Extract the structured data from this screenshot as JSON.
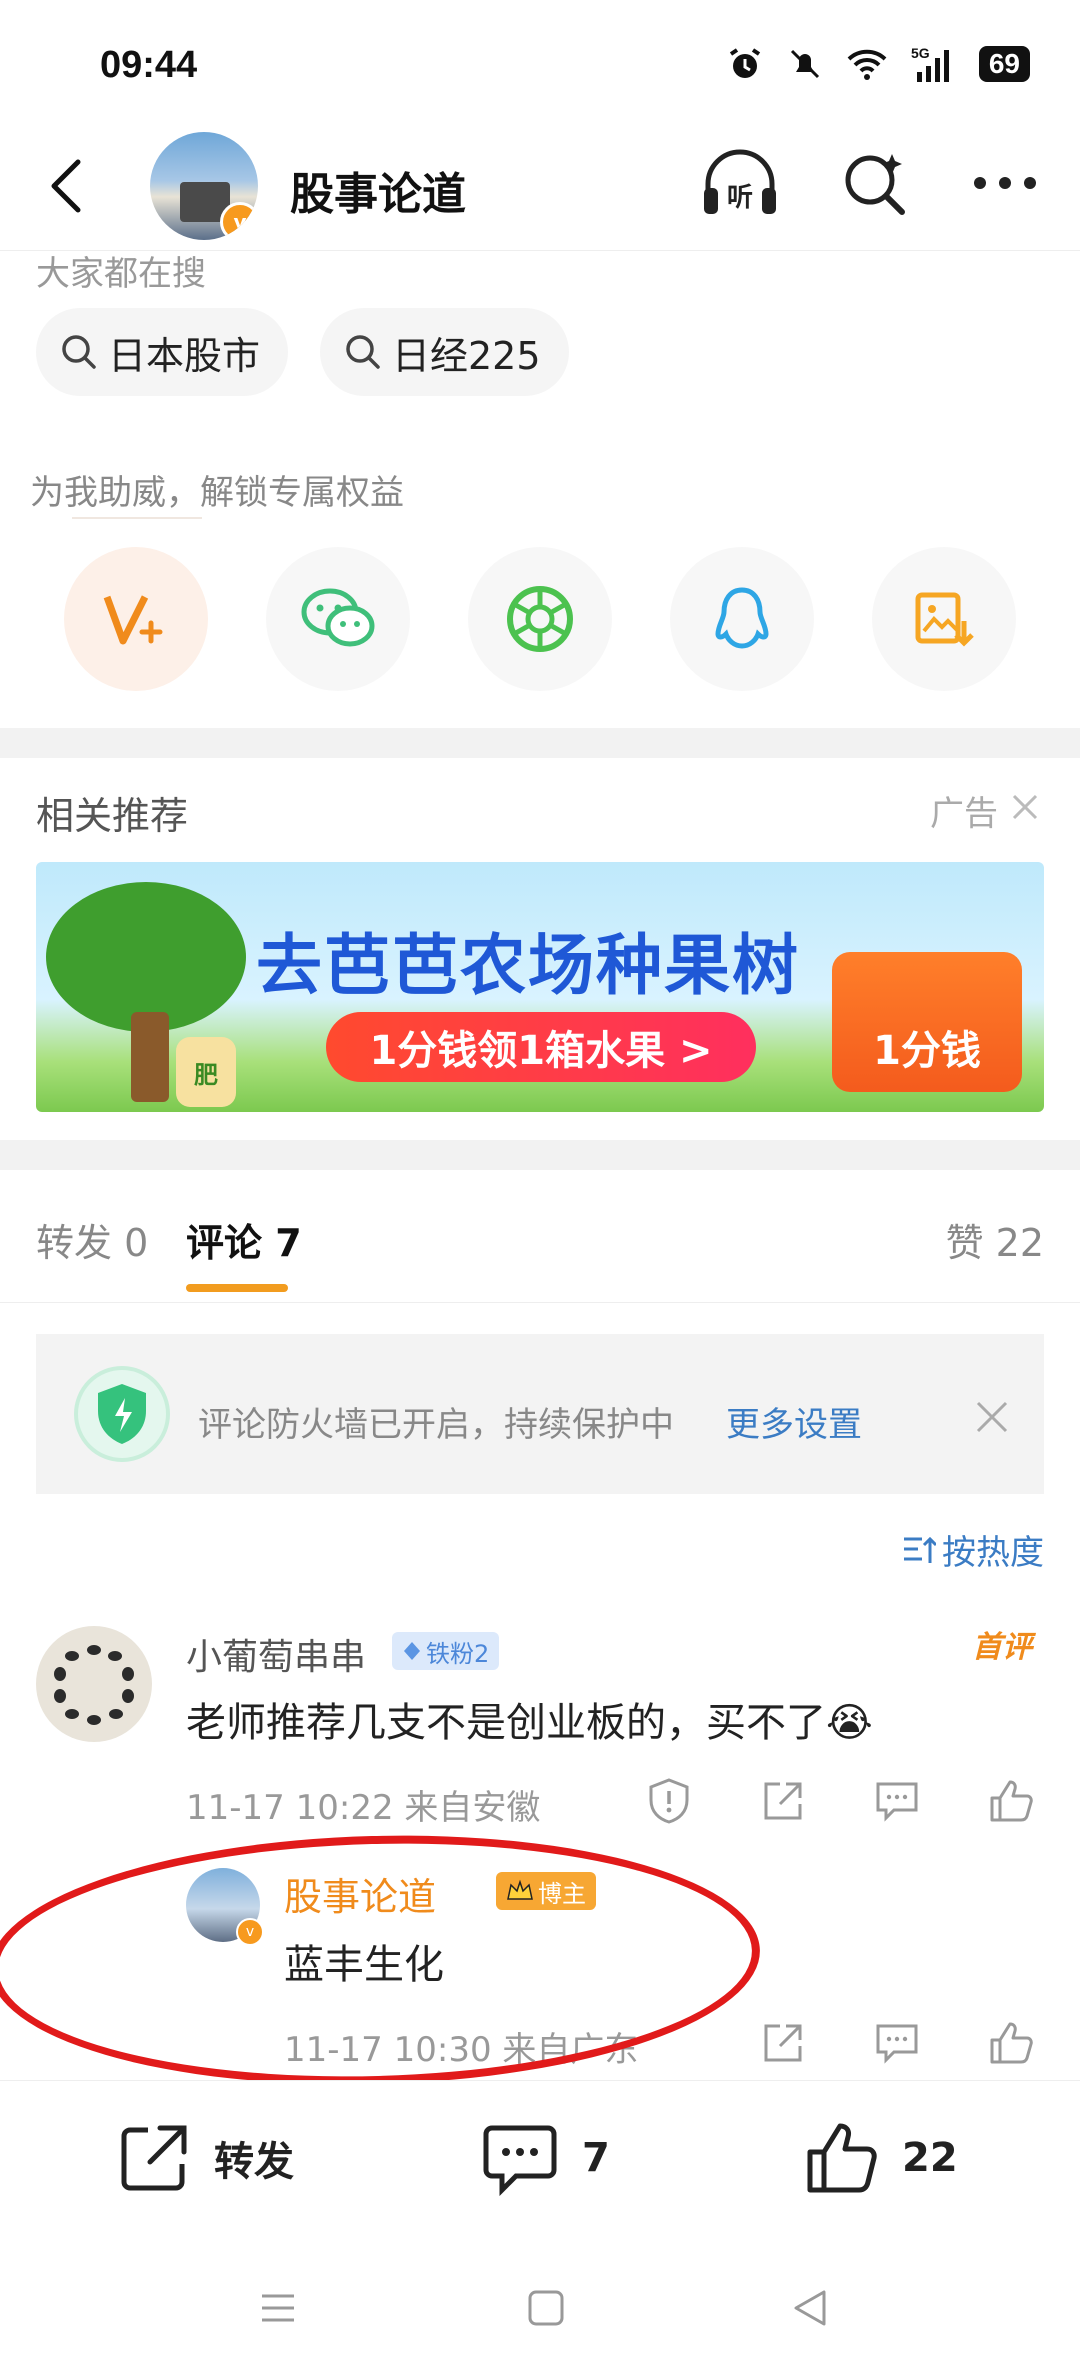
{
  "status_bar": {
    "time": "09:44",
    "battery": "69"
  },
  "header": {
    "title": "股事论道"
  },
  "search": {
    "hint": "大家都在搜",
    "chips": [
      "日本股市",
      "日经225"
    ]
  },
  "support": {
    "title": "为我助威，解锁专属权益"
  },
  "recommend": {
    "title": "相关推荐",
    "ad_label": "广告",
    "banner": {
      "headline": "去芭芭农场种果树",
      "cta": "1分钱领1箱水果 >",
      "box_text": "1分钱",
      "bag_text": "肥"
    }
  },
  "tabs": {
    "repost": "转发 0",
    "comments": "评论 7",
    "likes": "赞 22"
  },
  "firewall": {
    "text": "评论防火墙已开启，持续保护中",
    "link": "更多设置"
  },
  "sort": {
    "label": "按热度"
  },
  "comment": {
    "user": "小葡萄串串",
    "badge": "铁粉2",
    "first_label": "首评",
    "text": "老师推荐几支不是创业板的，买不了😭",
    "time": "11-17 10:22",
    "location": "来自安徽"
  },
  "reply": {
    "user": "股事论道",
    "badge": "博主",
    "text": "蓝丰生化",
    "time": "11-17 10:30",
    "location": "来自广东"
  },
  "bottom_bar": {
    "repost": "转发",
    "comments": "7",
    "likes": "22"
  },
  "colors": {
    "accent_orange": "#f29c1f",
    "link_blue": "#3b7cc4",
    "annotation_red": "#e11a1a"
  }
}
